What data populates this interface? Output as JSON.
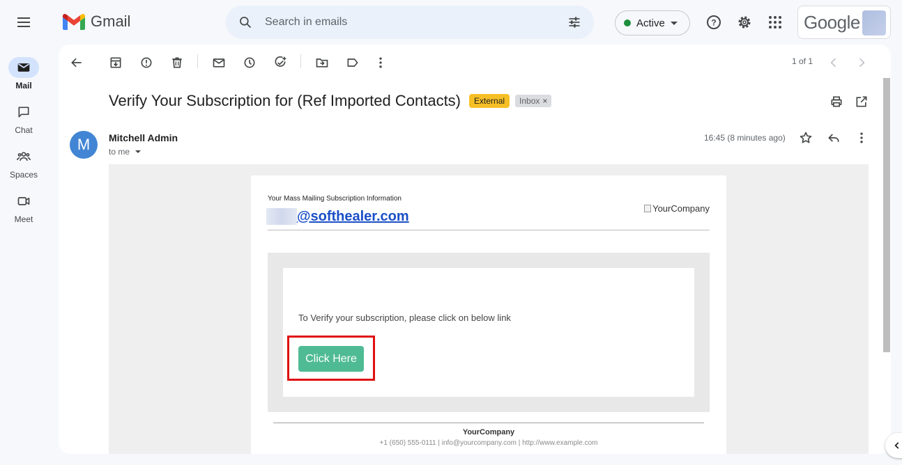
{
  "app": {
    "name": "Gmail"
  },
  "search": {
    "placeholder": "Search in emails"
  },
  "status": {
    "label": "Active",
    "color": "#1e8e3e"
  },
  "account": {
    "brand": "Google"
  },
  "rail": {
    "items": [
      {
        "label": "Mail",
        "icon": "mail-icon",
        "active": true
      },
      {
        "label": "Chat",
        "icon": "chat-icon"
      },
      {
        "label": "Spaces",
        "icon": "spaces-icon"
      },
      {
        "label": "Meet",
        "icon": "meet-icon"
      }
    ]
  },
  "toolbar": {
    "icons": [
      "back-icon",
      "archive-icon",
      "report-spam-icon",
      "delete-icon",
      "mark-unread-icon",
      "snooze-icon",
      "add-task-icon",
      "move-to-icon",
      "label-icon",
      "more-icon"
    ],
    "pager": "1 of 1"
  },
  "message": {
    "subject": "Verify Your Subscription for (Ref Imported Contacts)",
    "labels": {
      "external": "External",
      "inbox": "Inbox",
      "inbox_remove": "×"
    },
    "sender": {
      "initial": "M",
      "name": "Mitchell Admin",
      "to": "to me",
      "avatar_color": "#4285d4"
    },
    "timestamp": "16:45 (8 minutes ago)"
  },
  "mail_body": {
    "caption": "Your Mass Mailing Subscription Information",
    "email_domain": "@softhealer.com",
    "company_img_alt": "YourCompany",
    "verify_text": "To Verify your subscription, please click on below link",
    "button_label": "Click Here",
    "button_color": "#4fbb95",
    "highlight_color": "#e01010",
    "footer_company": "YourCompany",
    "footer_contact": "+1 (650) 555-0111 | info@yourcompany.com | http://www.example.com"
  }
}
